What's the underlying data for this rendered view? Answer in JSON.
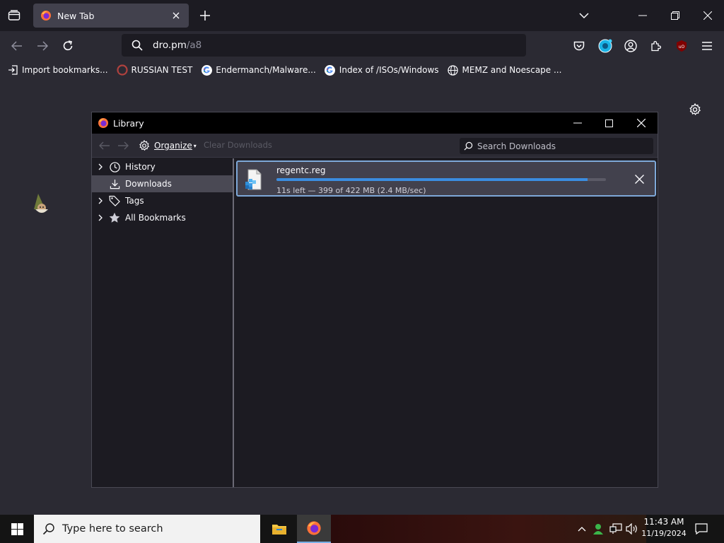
{
  "browser": {
    "tab": {
      "title": "New Tab"
    },
    "url": {
      "host": "dro.pm",
      "path": "/a8"
    },
    "bookmarks": [
      {
        "label": "Import bookmarks...",
        "icon": "import-icon"
      },
      {
        "label": "RUSSIAN TEST",
        "icon": "bookmark-favicon-icon"
      },
      {
        "label": "Endermanch/Malware...",
        "icon": "google-icon"
      },
      {
        "label": "Index of /ISOs/Windows",
        "icon": "google-icon"
      },
      {
        "label": "MEMZ and Noescape ...",
        "icon": "globe-icon"
      }
    ]
  },
  "library": {
    "title": "Library",
    "toolbar": {
      "organize_label": "Organize",
      "clear_label": "Clear Downloads",
      "search_placeholder": "Search Downloads"
    },
    "sidebar": [
      {
        "label": "History",
        "icon": "clock-icon",
        "expandable": true,
        "selected": false
      },
      {
        "label": "Downloads",
        "icon": "download-icon",
        "expandable": false,
        "selected": true
      },
      {
        "label": "Tags",
        "icon": "tag-icon",
        "expandable": true,
        "selected": false
      },
      {
        "label": "All Bookmarks",
        "icon": "star-icon",
        "expandable": true,
        "selected": false
      }
    ],
    "download": {
      "filename": "regentc.reg",
      "status": "11s left — 399 of 422 MB (2.4 MB/sec)",
      "progress_percent": 94.5
    }
  },
  "taskbar": {
    "search_placeholder": "Type here to search",
    "time": "11:43 AM",
    "date": "11/19/2024"
  },
  "colors": {
    "accent": "#3b8de0",
    "chrome_dark": "#1c1b22",
    "chrome": "#2b2a33",
    "selected_row": "#4a4954"
  }
}
